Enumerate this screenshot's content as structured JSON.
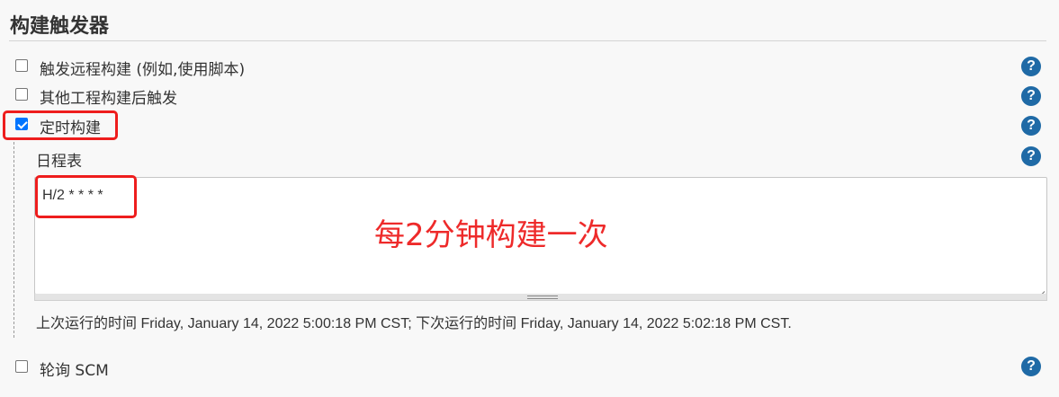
{
  "section": {
    "title": "构建触发器"
  },
  "triggers": [
    {
      "label": "触发远程构建 (例如,使用脚本)",
      "checked": false,
      "help": "?"
    },
    {
      "label": "其他工程构建后触发",
      "checked": false,
      "help": "?"
    },
    {
      "label": "定时构建",
      "checked": true,
      "help": "?"
    }
  ],
  "schedule": {
    "label": "日程表",
    "help": "?",
    "value": "H/2 * * * *",
    "last_run_label": "上次运行的时间",
    "last_run_time": " Friday, January 14, 2022 5:00:18 PM CST; ",
    "next_run_label": "下次运行的时间",
    "next_run_time": " Friday, January 14, 2022 5:02:18 PM CST."
  },
  "poll_scm": {
    "label": "轮询 SCM",
    "checked": false,
    "help": "?"
  },
  "annotation": {
    "text": "每2分钟构建一次",
    "color": "#ee1d1d"
  },
  "colors": {
    "checkbox_checked": "#0075ff",
    "help_icon": "#1f6aa6"
  }
}
